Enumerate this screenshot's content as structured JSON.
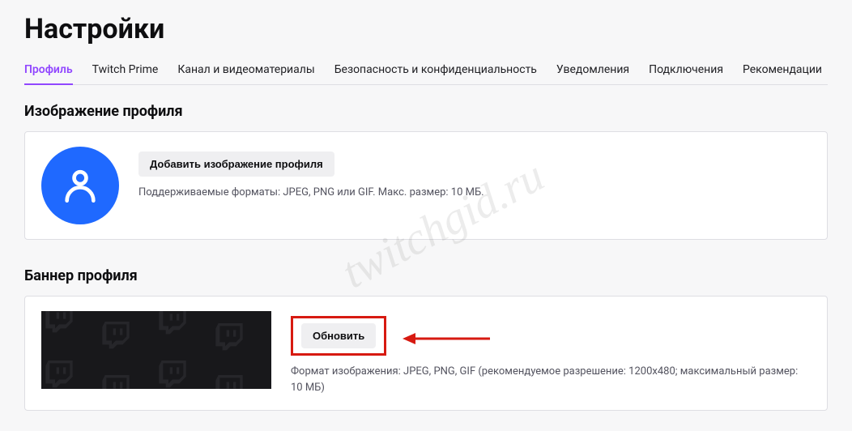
{
  "pageTitle": "Настройки",
  "tabs": [
    {
      "label": "Профиль",
      "active": true
    },
    {
      "label": "Twitch Prime"
    },
    {
      "label": "Канал и видеоматериалы"
    },
    {
      "label": "Безопасность и конфиденциальность"
    },
    {
      "label": "Уведомления"
    },
    {
      "label": "Подключения"
    },
    {
      "label": "Рекомендации"
    }
  ],
  "profileImage": {
    "sectionTitle": "Изображение профиля",
    "button": "Добавить изображение профиля",
    "helper": "Поддерживаемые форматы: JPEG, PNG или GIF. Макс. размер: 10 МБ."
  },
  "profileBanner": {
    "sectionTitle": "Баннер профиля",
    "button": "Обновить",
    "helper": "Формат изображения: JPEG, PNG, GIF (рекомендуемое разрешение: 1200x480; максимальный размер: 10 МБ)"
  },
  "watermark": "twitchgid.ru"
}
